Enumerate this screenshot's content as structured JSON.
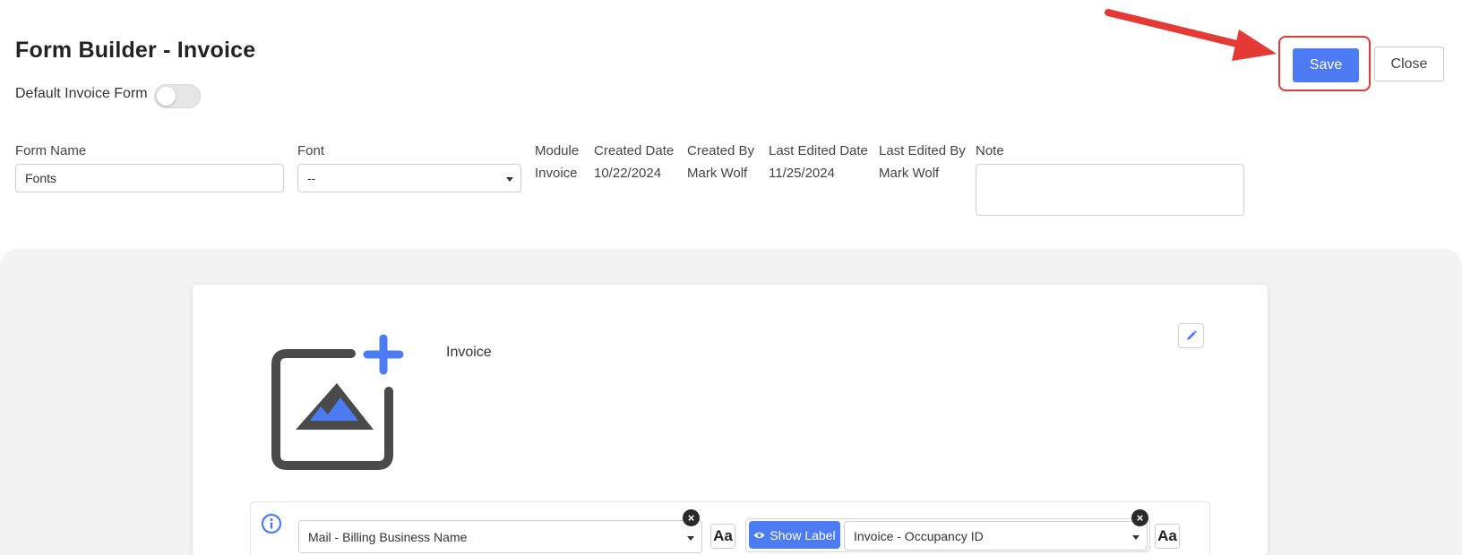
{
  "page": {
    "title": "Form Builder - Invoice",
    "default_toggle_label": "Default Invoice Form"
  },
  "actions": {
    "save_label": "Save",
    "close_label": "Close"
  },
  "fields": {
    "form_name": {
      "label": "Form Name",
      "value": "Fonts"
    },
    "font": {
      "label": "Font",
      "value": "--"
    },
    "module": {
      "label": "Module",
      "value": "Invoice"
    },
    "created_date": {
      "label": "Created Date",
      "value": "10/22/2024"
    },
    "created_by": {
      "label": "Created By",
      "value": "Mark Wolf"
    },
    "last_edited_date": {
      "label": "Last Edited Date",
      "value": "11/25/2024"
    },
    "last_edited_by": {
      "label": "Last Edited By",
      "value": "Mark Wolf"
    },
    "note": {
      "label": "Note",
      "value": ""
    }
  },
  "canvas": {
    "header_text": "Invoice",
    "row": {
      "left_select": "Mail - Billing Business Name",
      "show_label_button": "Show Label",
      "right_select": "Invoice - Occupancy ID",
      "font_style_glyph": "Aa",
      "remove_glyph": "×"
    }
  },
  "colors": {
    "accent": "#4c7bf3",
    "annotation": "#e53935",
    "background": "#f3f3f3"
  },
  "icons": [
    "add-image-icon",
    "pencil-icon",
    "info-icon",
    "eye-icon",
    "remove-icon",
    "caret-down-icon",
    "annotation-arrow-icon"
  ]
}
